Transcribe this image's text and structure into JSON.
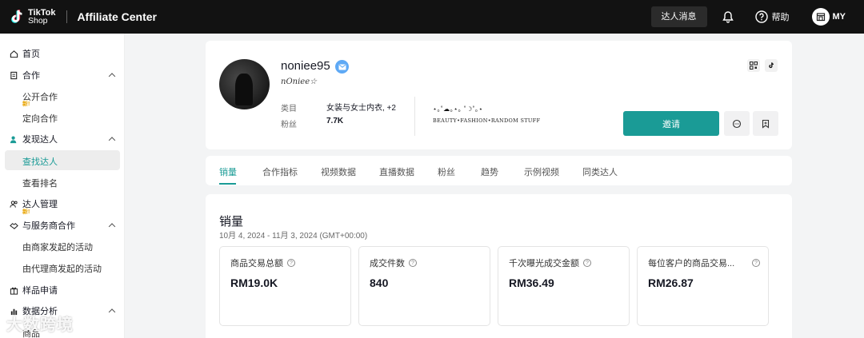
{
  "header": {
    "logo_line1": "TikTok",
    "logo_line2": "Shop",
    "app_title": "Affiliate Center",
    "messages_button": "达人消息",
    "help_label": "帮助",
    "user_label": "MY"
  },
  "sidebar": {
    "home": "首页",
    "cooperation": "合作",
    "open_cooperation": "公开合作",
    "new_badge": "新!",
    "targeted_cooperation": "定向合作",
    "discover": "发现达人",
    "find_creators": "查找达人",
    "view_rankings": "查看排名",
    "creator_management": "达人管理",
    "service_partner": "与服务商合作",
    "merchant_campaigns": "由商家发起的活动",
    "agency_campaigns": "由代理商发起的活动",
    "sample_requests": "样品申请",
    "data_analysis": "数据分析",
    "products": "商品"
  },
  "profile": {
    "name": "noniee95",
    "handle": "nOniee☆",
    "category_label": "类目",
    "category_value": "女装与女士内衣, +2",
    "followers_label": "粉丝",
    "followers_value": "7.7K",
    "bio_deco": "⋆｡˚☁︎｡⋆｡ ˚☽˚｡⋆",
    "bio": "BEAUTY•FASHION•RANDOM STUFF",
    "invite_button": "邀请"
  },
  "tabs": [
    "销量",
    "合作指标",
    "视频数据",
    "直播数据",
    "粉丝",
    "趋势",
    "示例视频",
    "同类达人"
  ],
  "sales": {
    "title": "销量",
    "date_range": "10月 4, 2024 - 11月 3, 2024 (GMT+00:00)",
    "metrics": [
      {
        "label": "商品交易总额",
        "value": "RM19.0K"
      },
      {
        "label": "成交件数",
        "value": "840"
      },
      {
        "label": "千次曝光成交金额",
        "value": "RM36.49"
      },
      {
        "label": "每位客户的商品交易...",
        "value": "RM26.87"
      }
    ]
  },
  "watermark": "大数跨境",
  "colors": {
    "accent": "#1a9b96",
    "topbar": "#121212"
  }
}
